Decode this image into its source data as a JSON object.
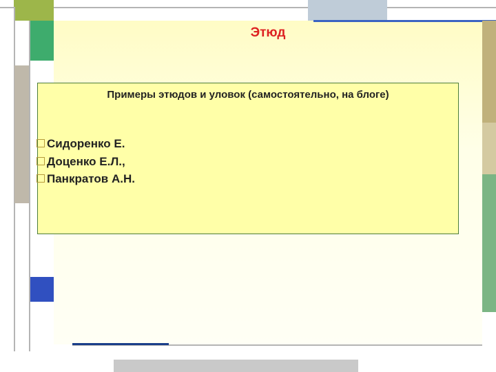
{
  "title": "Этюд",
  "card": {
    "subtitle": "Примеры этюдов и уловок (самостоятельно, на блоге)",
    "authors": [
      "Сидоренко  Е.",
      "Доценко Е.Л.,",
      "Панкратов А.Н."
    ]
  }
}
